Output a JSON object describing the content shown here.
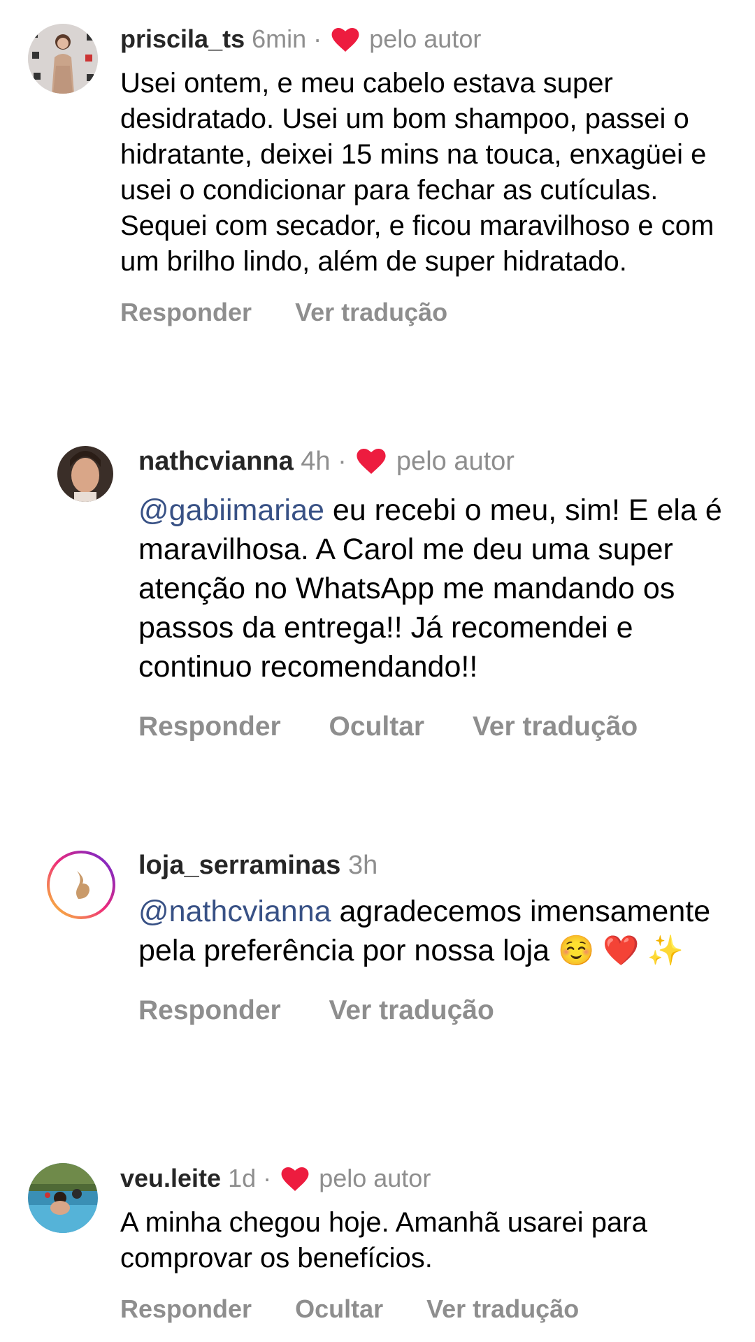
{
  "comments": [
    {
      "username": "priscila_ts",
      "time": "6min",
      "separator": "·",
      "liked_label": "pelo autor",
      "text": "Usei ontem, e meu cabelo estava super desidratado. Usei um bom shampoo, passei o hidratante, deixei 15 mins na touca, enxagüei e usei o condicionar para fechar as cutículas. Sequei com secador, e ficou maravilhoso e com um brilho lindo, além de super hidratado.",
      "actions": [
        "Responder",
        "Ver tradução"
      ]
    },
    {
      "username": "nathcvianna",
      "time": "4h",
      "separator": "·",
      "liked_label": "pelo autor",
      "mention": "@gabiimariae",
      "text": " eu recebi o meu, sim! E ela é maravilhosa. A Carol me deu uma super atenção no WhatsApp me mandando os passos da entrega!! Já recomendei e continuo recomendando!!",
      "actions": [
        "Responder",
        "Ocultar",
        "Ver tradução"
      ]
    },
    {
      "username": "loja_serraminas",
      "time": "3h",
      "mention": "@nathcvianna",
      "text": " agradecemos imensamente pela preferência por nossa loja ",
      "emojis": "☺️ ❤️ ✨",
      "actions": [
        "Responder",
        "Ver tradução"
      ]
    },
    {
      "username": "veu.leite",
      "time": "1d",
      "separator": "·",
      "liked_label": "pelo autor",
      "text": "A minha chegou hoje. Amanhã usarei para comprovar os benefícios.",
      "actions": [
        "Responder",
        "Ocultar",
        "Ver tradução"
      ]
    }
  ],
  "colors": {
    "heart": "#ed1c3f",
    "mention": "#385185",
    "secondary": "#8e8e8e",
    "story_ring": [
      "#f9ce34",
      "#ee2a7b",
      "#6228d7"
    ]
  }
}
